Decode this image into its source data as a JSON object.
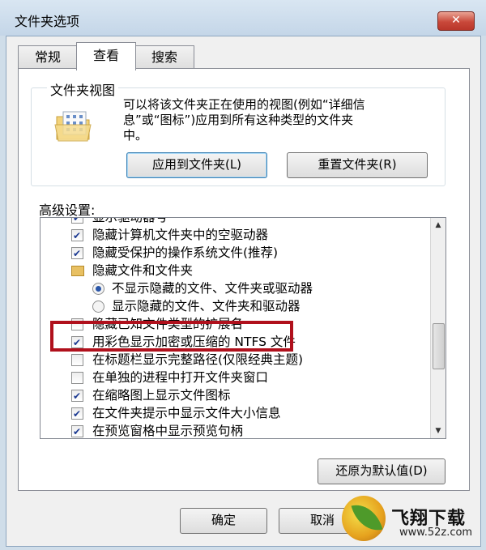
{
  "window": {
    "title": "文件夹选项",
    "close_glyph": "✕"
  },
  "tabs": [
    {
      "label": "常规",
      "active": false
    },
    {
      "label": "查看",
      "active": true
    },
    {
      "label": "搜索",
      "active": false
    }
  ],
  "folder_views": {
    "legend": "文件夹视图",
    "desc_line1": "可以将该文件夹正在使用的视图(例如“详细信",
    "desc_line2": "息”或“图标”)应用到所有这种类型的文件夹",
    "desc_line3": "中。",
    "apply_button": "应用到文件夹(L)",
    "reset_button": "重置文件夹(R)",
    "icon": "folder-view-icon"
  },
  "advanced": {
    "label": "高级设置:",
    "items": [
      {
        "type": "checkbox",
        "checked": true,
        "label": "显示驱动器号"
      },
      {
        "type": "checkbox",
        "checked": true,
        "label": "隐藏计算机文件夹中的空驱动器"
      },
      {
        "type": "checkbox",
        "checked": true,
        "label": "隐藏受保护的操作系统文件(推荐)"
      },
      {
        "type": "folder",
        "label": "隐藏文件和文件夹"
      },
      {
        "type": "radio",
        "checked": true,
        "label": "不显示隐藏的文件、文件夹或驱动器"
      },
      {
        "type": "radio",
        "checked": false,
        "label": "显示隐藏的文件、文件夹和驱动器"
      },
      {
        "type": "checkbox",
        "checked": false,
        "label": "隐藏已知文件类型的扩展名"
      },
      {
        "type": "checkbox",
        "checked": true,
        "label": "用彩色显示加密或压缩的 NTFS 文件"
      },
      {
        "type": "checkbox",
        "checked": false,
        "label": "在标题栏显示完整路径(仅限经典主题)"
      },
      {
        "type": "checkbox",
        "checked": false,
        "label": "在单独的进程中打开文件夹窗口"
      },
      {
        "type": "checkbox",
        "checked": true,
        "label": "在缩略图上显示文件图标"
      },
      {
        "type": "checkbox",
        "checked": true,
        "label": "在文件夹提示中显示文件大小信息"
      },
      {
        "type": "checkbox",
        "checked": true,
        "label": "在预览窗格中显示预览句柄"
      }
    ],
    "restore_defaults": "还原为默认值(D)"
  },
  "footer": {
    "ok": "确定",
    "cancel": "取消"
  },
  "watermark": {
    "brand": "飞翔下载",
    "url": "www.52z.com"
  },
  "colors": {
    "highlight_border": "#b0101c",
    "check": "#1c3a92"
  }
}
